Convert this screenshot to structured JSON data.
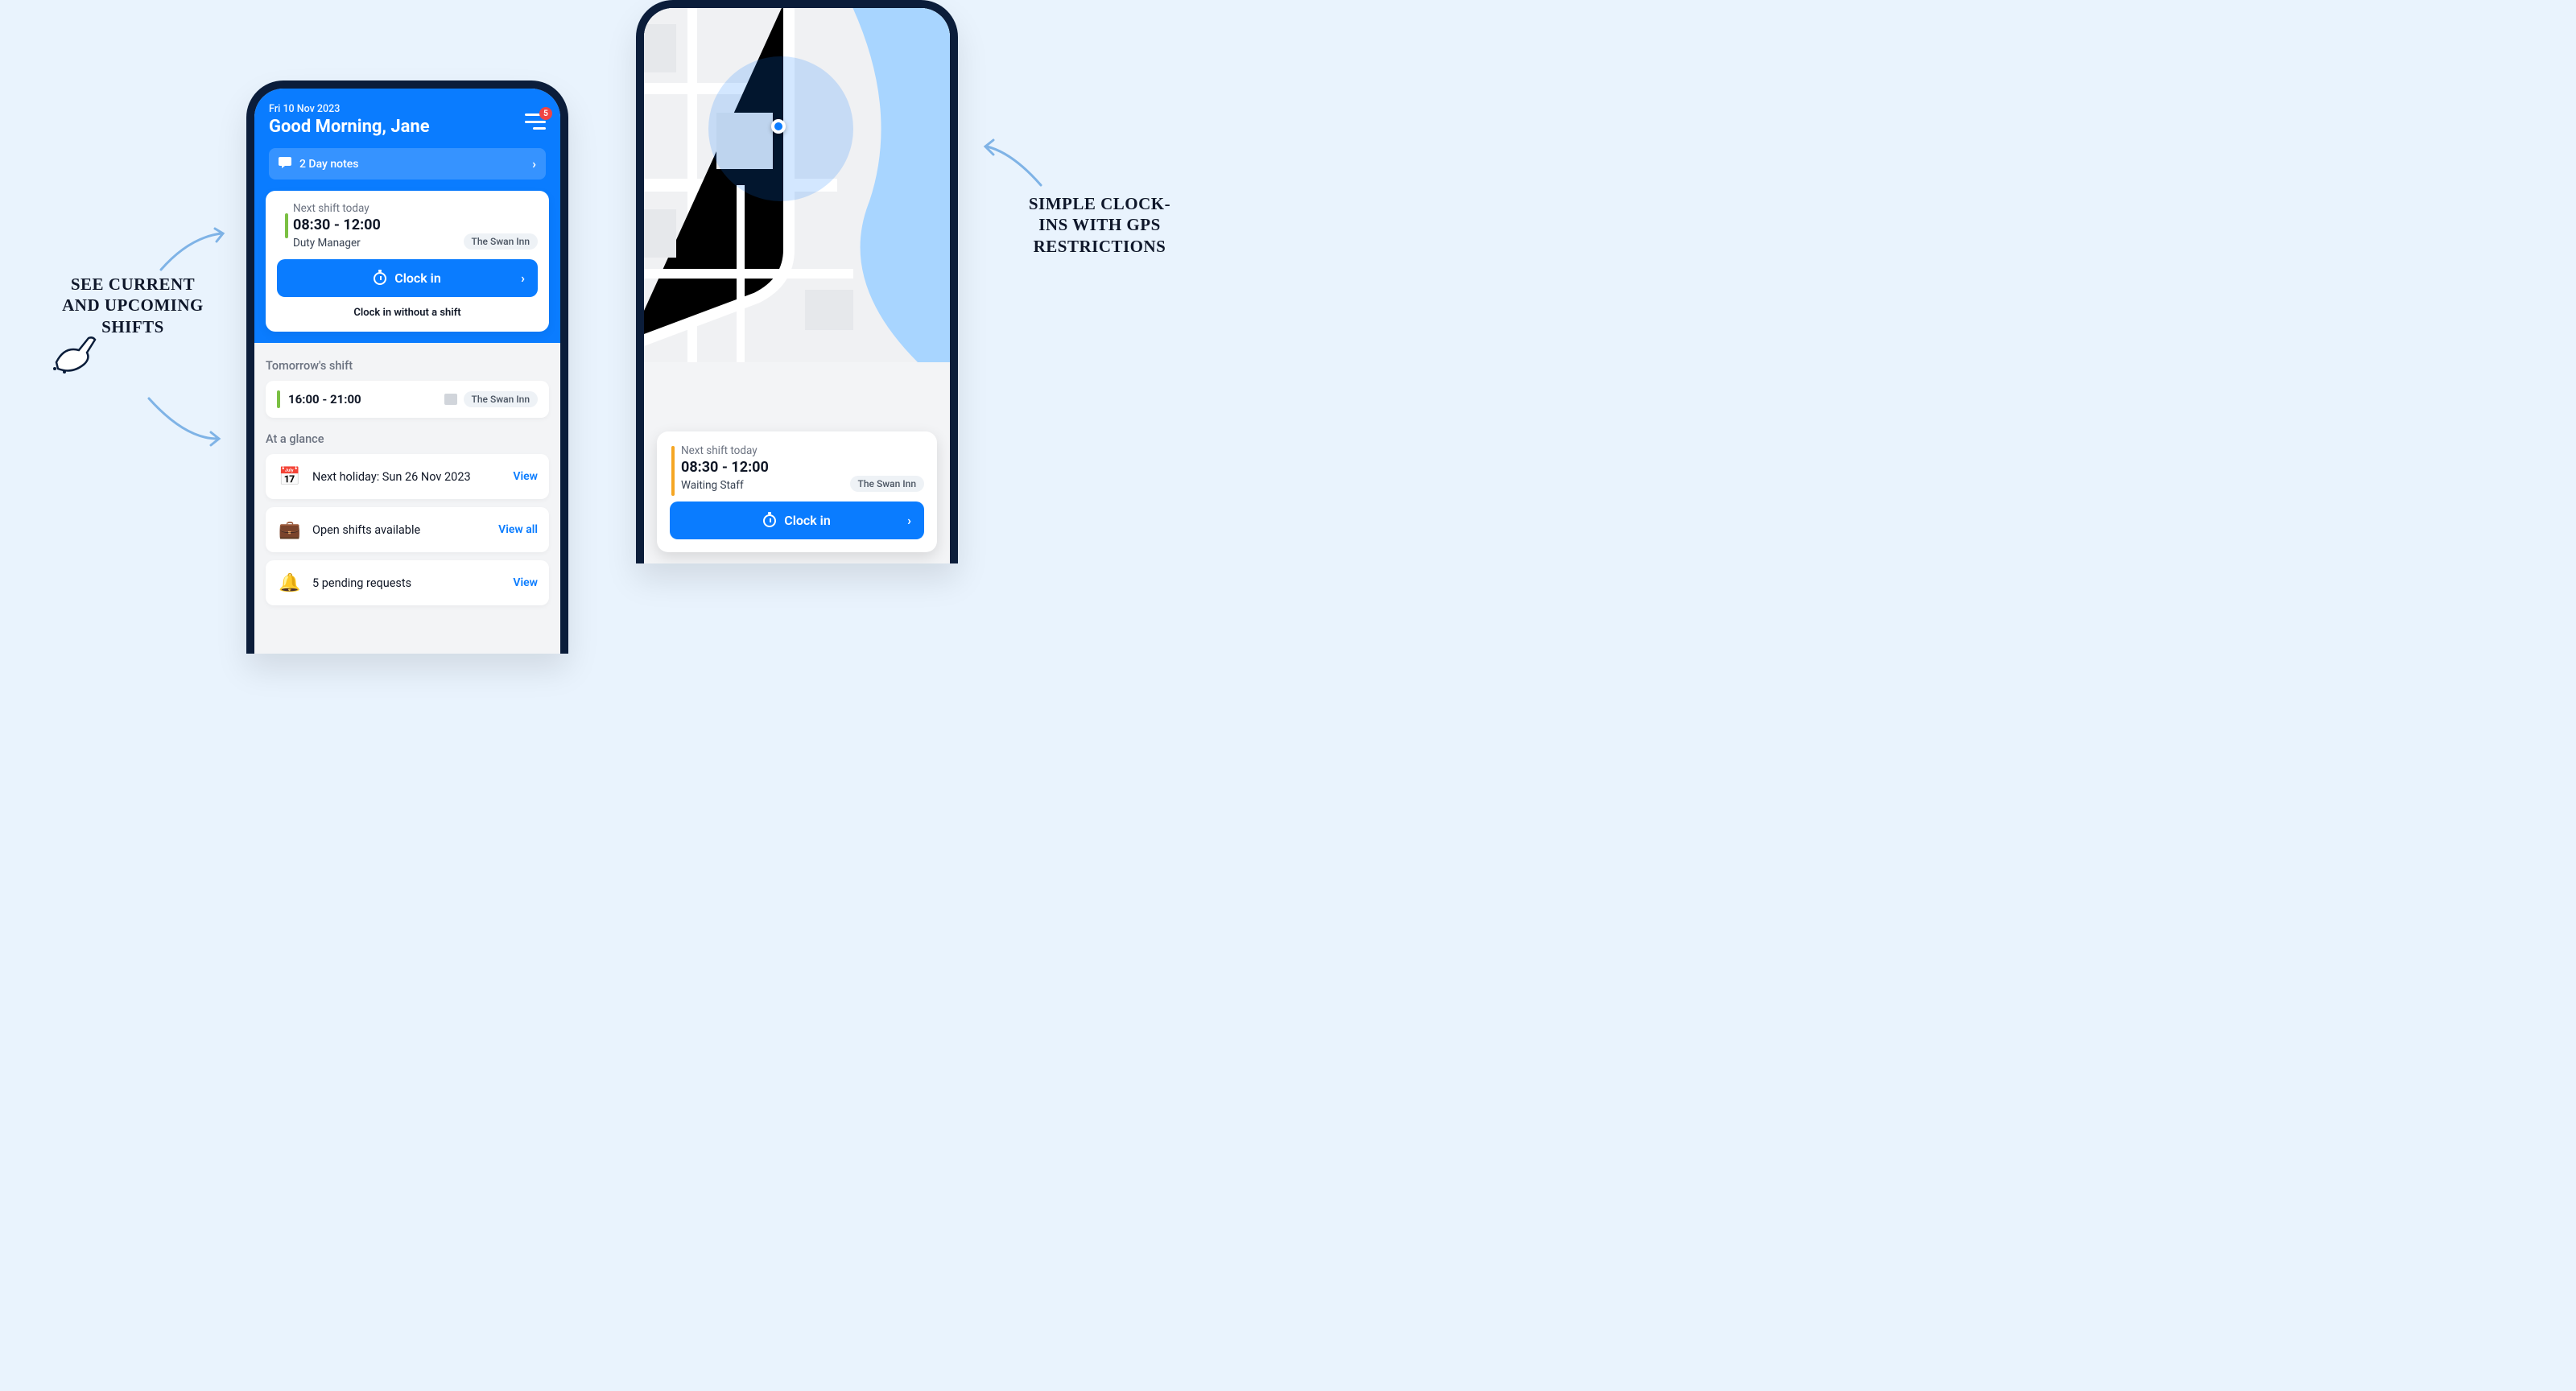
{
  "annotations": {
    "left": "SEE CURRENT AND UPCOMING SHIFTS",
    "right": "SIMPLE CLOCK-INS WITH GPS RESTRICTIONS"
  },
  "phoneA": {
    "date": "Fri 10 Nov 2023",
    "greeting": "Good Morning, Jane",
    "notification_count": "5",
    "day_notes": "2 Day notes",
    "next_shift": {
      "label": "Next shift today",
      "time": "08:30 - 12:00",
      "role": "Duty Manager",
      "location": "The Swan Inn"
    },
    "clock_in": "Clock in",
    "clock_in_noshift": "Clock in without a shift",
    "tomorrow_label": "Tomorrow's shift",
    "tomorrow": {
      "time": "16:00 - 21:00",
      "location": "The Swan Inn"
    },
    "glance_label": "At a glance",
    "glance": [
      {
        "text": "Next holiday: Sun 26 Nov 2023",
        "link": "View"
      },
      {
        "text": "Open shifts available",
        "link": "View all"
      },
      {
        "text": "5 pending requests",
        "link": "View"
      }
    ]
  },
  "phoneB": {
    "next_shift": {
      "label": "Next shift today",
      "time": "08:30 - 12:00",
      "role": "Waiting Staff",
      "location": "The Swan Inn"
    },
    "clock_in": "Clock in"
  }
}
